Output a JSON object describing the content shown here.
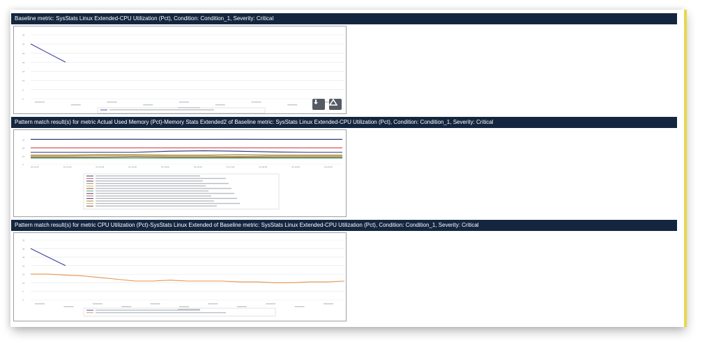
{
  "sections": [
    {
      "header": "Baseline metric: SysStats Linux Extended-CPU Utilization (Pct), Condition: Condition_1, Severity: Critical",
      "toolbar": {
        "download_icon": "download-icon",
        "drive_icon": "drive-upload-icon"
      },
      "chart_data": {
        "type": "line",
        "ylim": [
          0,
          35
        ],
        "yticks": [
          "35",
          "30",
          "25",
          "20",
          "15",
          "10",
          "5",
          "0"
        ],
        "grid": true,
        "legend": "bottom",
        "series": [
          {
            "color": "#3b3f9c",
            "values": [
              30,
              25,
              20
            ]
          }
        ]
      }
    },
    {
      "header": "Pattern match result(s) for metric Actual Used Memory (Pct)-Memory Stats Extended2 of Baseline metric: SysStats Linux Extended-CPU Utilization (Pct), Condition: Condition_1, Severity: Critical",
      "chart_data": {
        "type": "line",
        "ylim": [
          0,
          35
        ],
        "yticks": [
          "30",
          "20",
          "10",
          "0"
        ],
        "xticks": [
          "01:11:00",
          "01:12:00",
          "01:13:00",
          "01:14:00",
          "01:15:00",
          "01:16:00",
          "01:17:00",
          "01:18:00",
          "01:19:00",
          "01:20:00"
        ],
        "grid": true,
        "legend": "bottom",
        "series": [
          {
            "color": "#1b2a6b",
            "values": [
              30.5,
              30.5,
              30.6,
              30.6,
              30.5,
              30.5,
              30.6,
              30.5,
              30.5,
              30.5
            ]
          },
          {
            "color": "#d94848",
            "values": [
              20,
              20,
              20,
              20,
              20,
              20,
              20,
              20,
              20,
              20
            ]
          },
          {
            "color": "#26307a",
            "values": [
              14.5,
              14.5,
              14.5,
              14.5,
              16,
              16.5,
              16,
              15,
              14.5,
              14.5
            ]
          },
          {
            "color": "#8a7c2c",
            "values": [
              11,
              11,
              11.5,
              11.5,
              11,
              11,
              11.5,
              11,
              11,
              11
            ]
          },
          {
            "color": "#e0a23a",
            "values": [
              10,
              10,
              10.5,
              10.5,
              10,
              10,
              9.5,
              10,
              10,
              10
            ]
          },
          {
            "color": "#6b4226",
            "values": [
              8.5,
              8.5,
              8.5,
              9,
              8.5,
              8.5,
              8.5,
              8.5,
              8.5,
              8.5
            ]
          },
          {
            "color": "#3c9c6a",
            "values": [
              7.5,
              7.5,
              7.5,
              7.5,
              7.5,
              7.5,
              7.5,
              7.5,
              7.5,
              7.5
            ]
          }
        ]
      }
    },
    {
      "header": "Pattern match result(s) for metric CPU Utilization (Pct)-SysStats Linux Extended of Baseline metric: SysStats Linux Extended-CPU Utilization (Pct), Condition: Condition_1, Severity: Critical",
      "chart_data": {
        "type": "line",
        "ylim": [
          0,
          35
        ],
        "yticks": [
          "35",
          "30",
          "25",
          "20",
          "15",
          "10",
          "5",
          "0"
        ],
        "grid": true,
        "legend": "bottom",
        "series": [
          {
            "color": "#3b3f9c",
            "values": [
              30,
              25,
              20
            ]
          },
          {
            "color": "#e8934a",
            "values": [
              15,
              15,
              14.5,
              14,
              13,
              12,
              11,
              11,
              11.5,
              11,
              11,
              11,
              10.5,
              10.5,
              10,
              10,
              10.5,
              10.5,
              11
            ]
          }
        ]
      }
    }
  ]
}
